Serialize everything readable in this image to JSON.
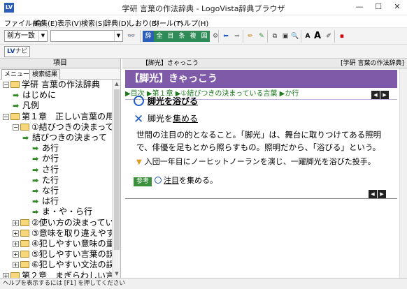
{
  "window": {
    "title": "学研 言葉の作法辞典 - LogoVista辞典ブラウザ",
    "minimize": "—",
    "maximize": "☐",
    "close": "✕"
  },
  "menubar": [
    "ファイル(F)",
    "編集(E)",
    "表示(V)",
    "検索(S)",
    "辞典(D)",
    "しおり(B)",
    "ツール(T)",
    "ヘルプ(H)"
  ],
  "toolbar": {
    "search_mode": "前方一致",
    "search_value": "",
    "lvnavi_label_lv": "LV",
    "lvnavi_label": "ナビ"
  },
  "left_pane": {
    "header": "項目",
    "tabs": [
      "メニュー",
      "検索結果"
    ],
    "tree": [
      {
        "type": "folder",
        "label": "学研 言葉の作法辞典",
        "exp": "−"
      },
      {
        "type": "item",
        "label": "はじめに"
      },
      {
        "type": "item",
        "label": "凡例"
      },
      {
        "type": "folder",
        "label": "第１章　正しい言葉の用",
        "exp": "−"
      },
      {
        "type": "folder",
        "label": "①結びつきの決まって",
        "exp": "−"
      },
      {
        "type": "item",
        "label": "結びつきの決まって"
      },
      {
        "type": "item",
        "label": "あ行"
      },
      {
        "type": "item",
        "label": "か行"
      },
      {
        "type": "item",
        "label": "さ行"
      },
      {
        "type": "item",
        "label": "た行"
      },
      {
        "type": "item",
        "label": "な行"
      },
      {
        "type": "item",
        "label": "は行"
      },
      {
        "type": "item",
        "label": "ま・や・ら行"
      },
      {
        "type": "folder",
        "label": "②使い方の決まってい",
        "exp": "+"
      },
      {
        "type": "folder",
        "label": "③意味を取り違えやす",
        "exp": "+"
      },
      {
        "type": "folder",
        "label": "④犯しやすい意味の重",
        "exp": "+"
      },
      {
        "type": "folder",
        "label": "⑤犯しやすい言葉の誤",
        "exp": "+"
      },
      {
        "type": "folder",
        "label": "⑥犯しやすい文法の誤",
        "exp": "+"
      },
      {
        "type": "folder",
        "label": "第２章　まぎらわしい言",
        "exp": "+"
      },
      {
        "type": "folder",
        "label": "第３章　正しい敬語表現",
        "exp": "+"
      }
    ]
  },
  "right_pane": {
    "header_label": "【脚光】きゃっこう",
    "header_dict": "[学研 言葉の作法辞典]",
    "entry_title": "【脚光】きゃっこう",
    "breadcrumb": "▶目次 ▶第１章 ▶①結びつきの決まっている言葉 ▶か行",
    "correct_usage": "脚光を浴びる",
    "wrong_usage_prefix": "脚光を",
    "wrong_usage_underlined": "集める",
    "definition": "世間の注目の的となること。「脚光」は、舞台に取りつけてある照明で、俳優を足もとから照らすもの。照明だから、「浴びる」という。",
    "example": "入団一年目にノーヒットノーランを演じ、一躍脚光を浴びた投手。",
    "ref_tag": "参考",
    "ref_underlined": "注目",
    "ref_rest": "を集める。",
    "nav_prev": "◀",
    "nav_next": "▶"
  },
  "statusbar": "ヘルプを表示するには [F1] を押してください"
}
